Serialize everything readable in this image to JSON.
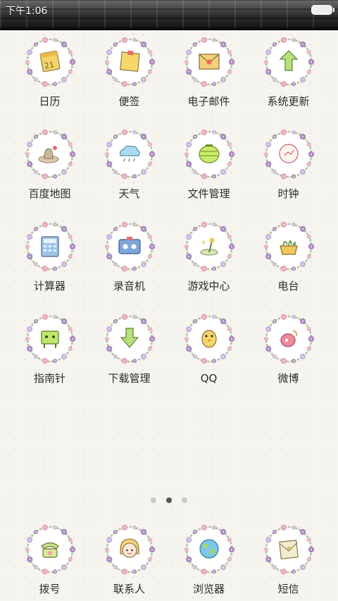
{
  "status_bar": {
    "time": "下午1:06"
  },
  "apps": [
    {
      "label": "日历",
      "icon": "calendar-icon"
    },
    {
      "label": "便签",
      "icon": "sticky-note-icon"
    },
    {
      "label": "电子邮件",
      "icon": "mail-icon"
    },
    {
      "label": "系统更新",
      "icon": "update-arrow-icon"
    },
    {
      "label": "百度地图",
      "icon": "map-pin-icon"
    },
    {
      "label": "天气",
      "icon": "cloud-icon"
    },
    {
      "label": "文件管理",
      "icon": "folder-lantern-icon"
    },
    {
      "label": "时钟",
      "icon": "clock-icon"
    },
    {
      "label": "计算器",
      "icon": "calculator-icon"
    },
    {
      "label": "录音机",
      "icon": "cassette-icon"
    },
    {
      "label": "游戏中心",
      "icon": "joystick-icon"
    },
    {
      "label": "电台",
      "icon": "radio-basket-icon"
    },
    {
      "label": "指南针",
      "icon": "compass-robot-icon"
    },
    {
      "label": "下载管理",
      "icon": "download-arrow-icon"
    },
    {
      "label": "QQ",
      "icon": "qq-penguin-icon"
    },
    {
      "label": "微博",
      "icon": "weibo-icon"
    }
  ],
  "page_indicator": {
    "count": 3,
    "active": 1
  },
  "dock": [
    {
      "label": "拨号",
      "icon": "phone-icon"
    },
    {
      "label": "联系人",
      "icon": "contact-girl-icon"
    },
    {
      "label": "浏览器",
      "icon": "globe-icon"
    },
    {
      "label": "短信",
      "icon": "envelope-icon"
    }
  ],
  "colors": {
    "wreath_purple": "#a98bc9",
    "wreath_pink": "#e7a6c8",
    "wreath_green": "#a9c28a",
    "label_text": "#2b2b2b",
    "status_bar": "#2e2e2e"
  }
}
